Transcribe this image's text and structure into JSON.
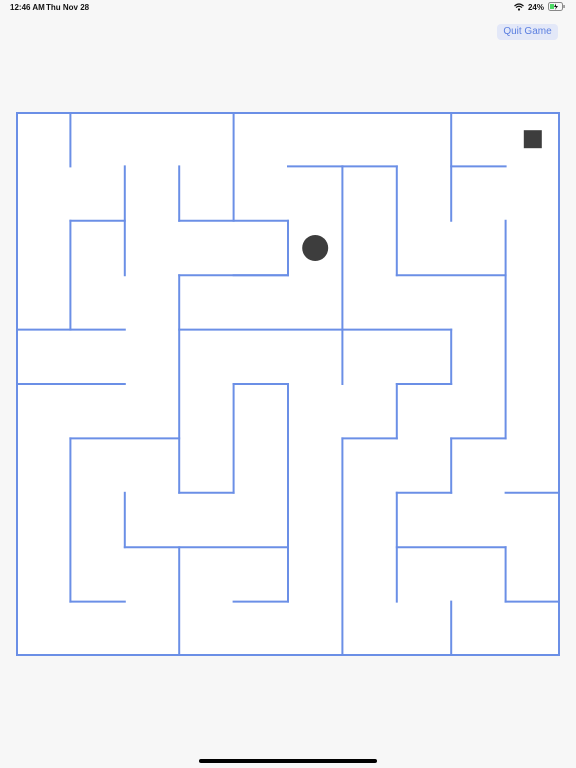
{
  "status_bar": {
    "time": "12:46 AM",
    "date": "Thu Nov 28",
    "battery_percent": "24%",
    "icons": [
      "wifi-icon",
      "battery-charging-icon"
    ]
  },
  "toolbar": {
    "quit_label": "Quit Game"
  },
  "colors": {
    "background": "#f7f7f7",
    "maze_wall": "#6b8fe6",
    "board": "#ffffff",
    "ball": "#3d3d3d",
    "goal": "#3d3d3d",
    "quit_text": "#5b7fe0",
    "quit_background": "#e3e8f8"
  },
  "maze": {
    "grid": {
      "columns": 10,
      "rows": 10
    },
    "horizontal_walls": [
      [
        0,
        0,
        10
      ],
      [
        5,
        1,
        6
      ],
      [
        6,
        1,
        7
      ],
      [
        8,
        1,
        9
      ],
      [
        1,
        2,
        2
      ],
      [
        3,
        2,
        5
      ],
      [
        4,
        3,
        5
      ],
      [
        3,
        3,
        5
      ],
      [
        7,
        3,
        9
      ],
      [
        0,
        4,
        2
      ],
      [
        3,
        4,
        8
      ],
      [
        0,
        5,
        2
      ],
      [
        4,
        5,
        5
      ],
      [
        1,
        6,
        3
      ],
      [
        6,
        6,
        7
      ],
      [
        7,
        5,
        8
      ],
      [
        8,
        6,
        9
      ],
      [
        3,
        7,
        4
      ],
      [
        7,
        7,
        8
      ],
      [
        9,
        7,
        10
      ],
      [
        2,
        8,
        5
      ],
      [
        7,
        8,
        9
      ],
      [
        1,
        9,
        2
      ],
      [
        4,
        9,
        5
      ],
      [
        9,
        9,
        10
      ],
      [
        0,
        10,
        10
      ]
    ],
    "vertical_walls": [
      [
        0,
        0,
        10
      ],
      [
        10,
        0,
        10
      ],
      [
        1,
        0,
        1
      ],
      [
        4,
        0,
        2
      ],
      [
        8,
        0,
        2
      ],
      [
        2,
        1,
        3
      ],
      [
        3,
        1,
        2
      ],
      [
        6,
        1,
        5
      ],
      [
        7,
        1,
        3
      ],
      [
        5,
        2,
        3
      ],
      [
        1,
        2,
        4
      ],
      [
        9,
        2,
        6
      ],
      [
        3,
        3,
        7
      ],
      [
        4,
        5,
        7
      ],
      [
        5,
        5,
        9
      ],
      [
        8,
        4,
        5
      ],
      [
        6,
        6,
        10
      ],
      [
        7,
        5,
        6
      ],
      [
        8,
        6,
        7
      ],
      [
        1,
        6,
        9
      ],
      [
        2,
        7,
        8
      ],
      [
        7,
        7,
        9
      ],
      [
        3,
        8,
        10
      ],
      [
        9,
        8,
        9
      ],
      [
        8,
        9,
        10
      ]
    ],
    "ball": {
      "column": 5.5,
      "row": 2.5
    },
    "goal": {
      "column": 9.5,
      "row": 0.5
    }
  }
}
